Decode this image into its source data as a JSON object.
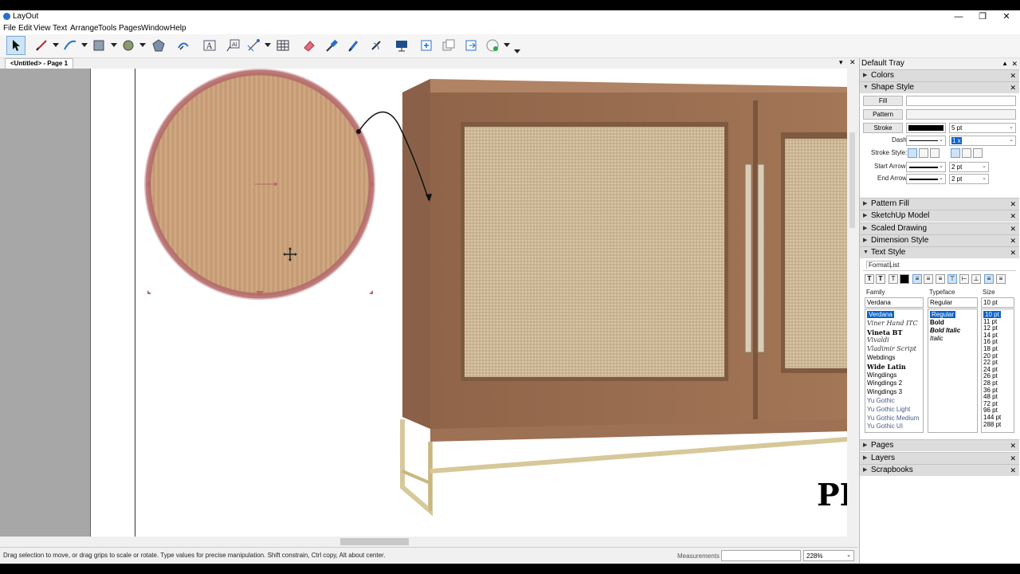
{
  "window": {
    "title": "LayOut",
    "min": "—",
    "max": "❐",
    "close": "✕"
  },
  "menu": [
    "File",
    "Edit",
    "View",
    "Text",
    "Arrange",
    "Tools",
    "Pages",
    "Window",
    "Help"
  ],
  "document": {
    "tab": "<Untitled> - Page 1",
    "pin": "▾",
    "close": "✕"
  },
  "canvas": {
    "page_text": "PI"
  },
  "status": {
    "hint": "Drag selection to move, or drag grips to scale or rotate. Type values for precise manipulation. Shift constrain, Ctrl copy, Alt about center.",
    "measurements_label": "Measurements",
    "measurements_value": "",
    "zoom": "228%"
  },
  "tray": {
    "title": "Default Tray",
    "panels": {
      "colors": "Colors",
      "shape_style": "Shape Style",
      "pattern_fill": "Pattern Fill",
      "sketchup_model": "SketchUp Model",
      "scaled_drawing": "Scaled Drawing",
      "dimension_style": "Dimension Style",
      "text_style": "Text Style",
      "pages": "Pages",
      "layers": "Layers",
      "scrapbooks": "Scrapbooks"
    },
    "shape": {
      "fill": "Fill",
      "pattern": "Pattern",
      "stroke": "Stroke",
      "stroke_width": "5 pt",
      "dashes": "Dashes:",
      "dash_scale": "1 x",
      "stroke_style": "Stroke Style:",
      "start_arrow": "Start Arrow:",
      "start_size": "2 pt",
      "end_arrow": "End Arrow:",
      "end_size": "2 pt",
      "stroke_color": "#000000"
    },
    "text": {
      "tabs": [
        "Format",
        "List"
      ],
      "family_label": "Family",
      "typeface_label": "Typeface",
      "size_label": "Size",
      "family": "Verdana",
      "typeface": "Regular",
      "size": "10 pt",
      "families": [
        "Verdana",
        "Viner Hand ITC",
        "Vineta BT",
        "Vivaldi",
        "Vladimir Script",
        "Webdings",
        "Wide Latin",
        "Wingdings",
        "Wingdings 2",
        "Wingdings 3",
        "Yu Gothic",
        "Yu Gothic Light",
        "Yu Gothic Medium",
        "Yu Gothic UI"
      ],
      "typefaces": [
        "Regular",
        "Bold",
        "Bold Italic",
        "Italic"
      ],
      "sizes": [
        "10 pt",
        "11 pt",
        "12 pt",
        "14 pt",
        "16 pt",
        "18 pt",
        "20 pt",
        "22 pt",
        "24 pt",
        "26 pt",
        "28 pt",
        "36 pt",
        "48 pt",
        "72 pt",
        "96 pt",
        "144 pt",
        "288 pt"
      ]
    }
  }
}
